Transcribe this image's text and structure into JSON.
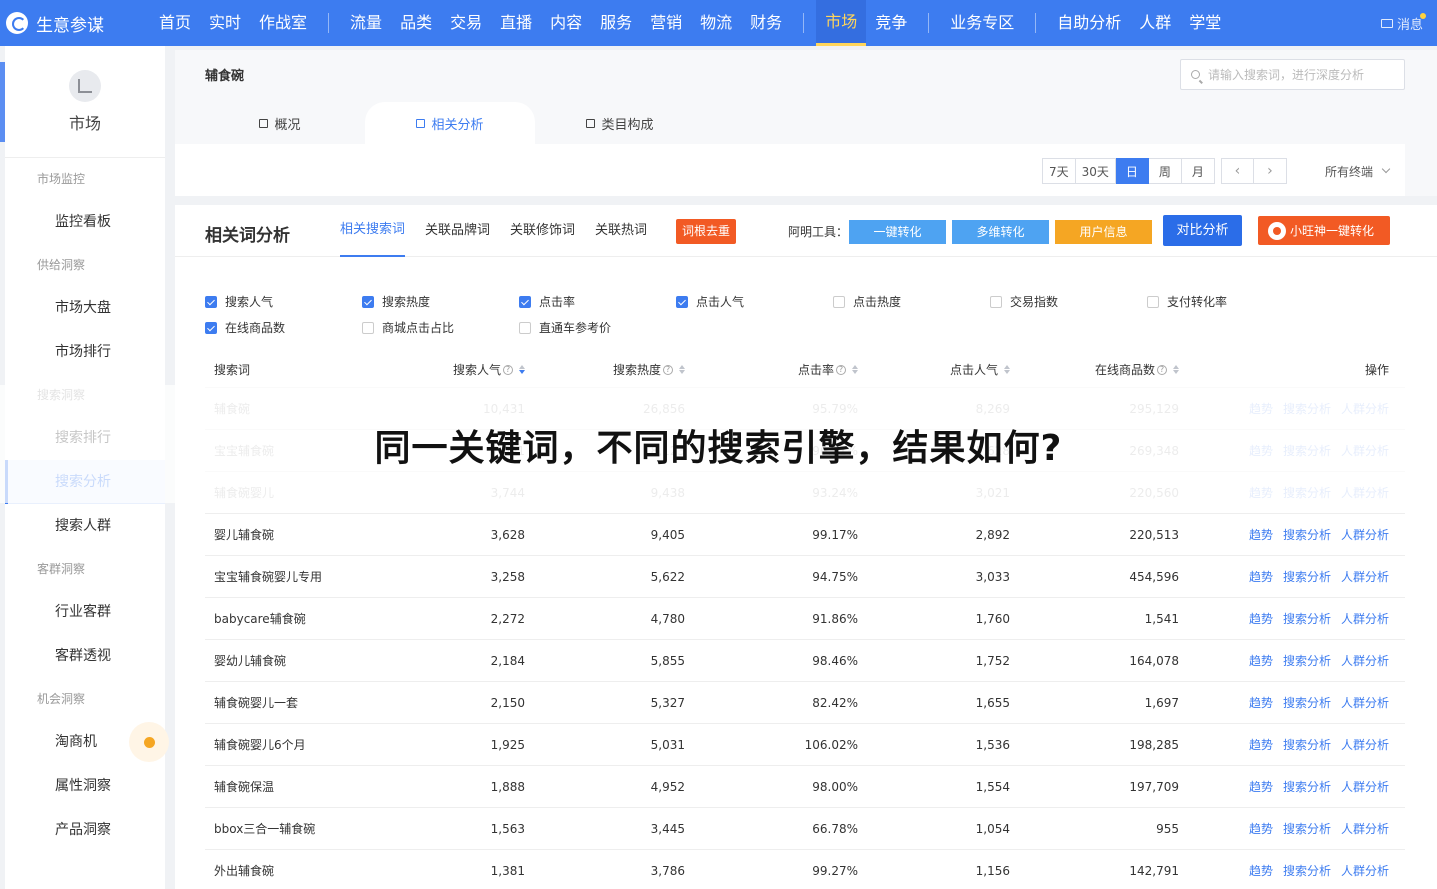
{
  "brand": {
    "name": "生意参谋"
  },
  "nav": {
    "groups": [
      [
        {
          "label": "首页"
        },
        {
          "label": "实时"
        },
        {
          "label": "作战室",
          "dot": true
        }
      ],
      [
        {
          "label": "流量"
        },
        {
          "label": "品类",
          "dot": true
        },
        {
          "label": "交易"
        },
        {
          "label": "直播"
        },
        {
          "label": "内容"
        },
        {
          "label": "服务"
        },
        {
          "label": "营销"
        },
        {
          "label": "物流"
        },
        {
          "label": "财务"
        }
      ],
      [
        {
          "label": "市场",
          "active": true
        },
        {
          "label": "竞争"
        }
      ],
      [
        {
          "label": "业务专区"
        }
      ],
      [
        {
          "label": "自助分析"
        },
        {
          "label": "人群"
        },
        {
          "label": "学堂"
        }
      ]
    ],
    "message": "消息"
  },
  "sidebar": {
    "title": "市场",
    "sections": [
      {
        "group": "市场监控",
        "items": [
          {
            "label": "监控看板"
          }
        ]
      },
      {
        "group": "供给洞察",
        "items": [
          {
            "label": "市场大盘"
          },
          {
            "label": "市场排行"
          }
        ]
      },
      {
        "group": "搜索洞察",
        "items": [
          {
            "label": "搜索排行"
          },
          {
            "label": "搜索分析",
            "active": true
          },
          {
            "label": "搜索人群"
          }
        ]
      },
      {
        "group": "客群洞察",
        "items": [
          {
            "label": "行业客群"
          },
          {
            "label": "客群透视"
          }
        ]
      },
      {
        "group": "机会洞察",
        "items": [
          {
            "label": "淘商机",
            "bubble": true
          },
          {
            "label": "属性洞察"
          },
          {
            "label": "产品洞察"
          }
        ]
      }
    ]
  },
  "header": {
    "breadcrumb": "辅食碗",
    "search_placeholder": "请输入搜索词，进行深度分析",
    "tabs": [
      {
        "label": "概况"
      },
      {
        "label": "相关分析",
        "active": true
      },
      {
        "label": "类目构成"
      }
    ],
    "date_buttons": [
      "7天",
      "30天",
      "日",
      "周",
      "月"
    ],
    "date_active": "日",
    "prev": "‹",
    "next": "›",
    "terminal": "所有终端"
  },
  "panel": {
    "title": "相关词分析",
    "subtabs": [
      {
        "label": "相关搜索词",
        "active": true
      },
      {
        "label": "关联品牌词"
      },
      {
        "label": "关联修饰词"
      },
      {
        "label": "关联热词"
      }
    ],
    "root_button": "词根去重",
    "tools_label": "阿明工具：",
    "tools": [
      {
        "label": "一键转化",
        "color": "#4ea3f2"
      },
      {
        "label": "多维转化",
        "color": "#4ea3f2"
      },
      {
        "label": "用户信息",
        "color": "#f5a623"
      }
    ],
    "compare_button": "对比分析",
    "wang_button": "小旺神一键转化"
  },
  "metrics": [
    {
      "label": "搜索人气",
      "checked": true
    },
    {
      "label": "搜索热度",
      "checked": true
    },
    {
      "label": "点击率",
      "checked": true
    },
    {
      "label": "点击人气",
      "checked": true
    },
    {
      "label": "点击热度",
      "checked": false
    },
    {
      "label": "交易指数",
      "checked": false
    },
    {
      "label": "支付转化率",
      "checked": false
    },
    {
      "label": "在线商品数",
      "checked": true
    },
    {
      "label": "商城点击占比",
      "checked": false
    },
    {
      "label": "直通车参考价",
      "checked": false
    }
  ],
  "table": {
    "headers": [
      "搜索词",
      "搜索人气",
      "搜索热度",
      "点击率",
      "点击人气",
      "在线商品数",
      "操作"
    ],
    "actions": [
      "趋势",
      "搜索分析",
      "人群分析"
    ],
    "rows": [
      [
        "辅食碗",
        "10,431",
        "26,856",
        "95.79%",
        "8,269",
        "295,129"
      ],
      [
        "宝宝辅食碗",
        "7,091",
        "18,123",
        "96.11%",
        "5,628",
        "269,348"
      ],
      [
        "辅食碗婴儿",
        "3,744",
        "9,438",
        "93.24%",
        "3,021",
        "220,560"
      ],
      [
        "婴儿辅食碗",
        "3,628",
        "9,405",
        "99.17%",
        "2,892",
        "220,513"
      ],
      [
        "宝宝辅食碗婴儿专用",
        "3,258",
        "5,622",
        "94.75%",
        "3,033",
        "454,596"
      ],
      [
        "babycare辅食碗",
        "2,272",
        "4,780",
        "91.86%",
        "1,760",
        "1,541"
      ],
      [
        "婴幼儿辅食碗",
        "2,184",
        "5,855",
        "98.46%",
        "1,752",
        "164,078"
      ],
      [
        "辅食碗婴儿一套",
        "2,150",
        "5,327",
        "82.42%",
        "1,655",
        "1,697"
      ],
      [
        "辅食碗婴儿6个月",
        "1,925",
        "5,031",
        "106.02%",
        "1,536",
        "198,285"
      ],
      [
        "辅食碗保温",
        "1,888",
        "4,952",
        "98.00%",
        "1,554",
        "197,709"
      ],
      [
        "bbox三合一辅食碗",
        "1,563",
        "3,445",
        "66.78%",
        "1,054",
        "955"
      ],
      [
        "外出辅食碗",
        "1,381",
        "3,786",
        "99.27%",
        "1,156",
        "142,791"
      ]
    ],
    "faded_rows": [
      0,
      1,
      2
    ]
  },
  "overlay_caption": "同一关键词，不同的搜索引擎，结果如何?"
}
